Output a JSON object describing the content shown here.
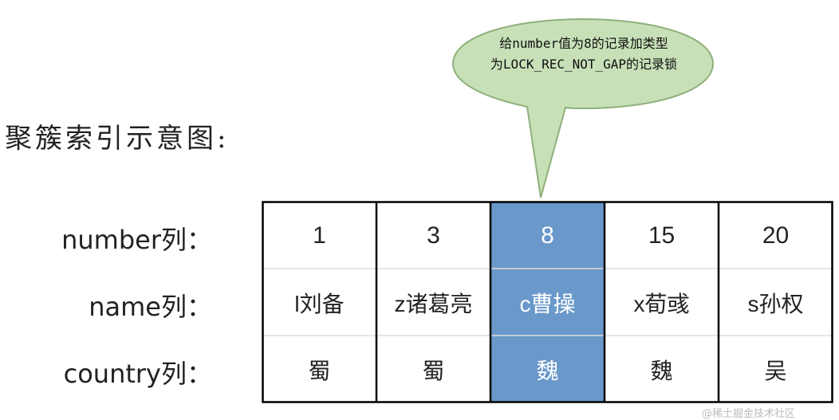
{
  "title": "聚簇索引示意图:",
  "callout": {
    "line1": "给number值为8的记录加类型",
    "line2": "为LOCK_REC_NOT_GAP的记录锁"
  },
  "row_labels": [
    "number列：",
    "name列：",
    "country列："
  ],
  "columns": [
    {
      "number": "1",
      "name": "l刘备",
      "country": "蜀"
    },
    {
      "number": "3",
      "name": "z诸葛亮",
      "country": "蜀"
    },
    {
      "number": "8",
      "name": "c曹操",
      "country": "魏"
    },
    {
      "number": "15",
      "name": "x荀彧",
      "country": "魏"
    },
    {
      "number": "20",
      "name": "s孙权",
      "country": "吴"
    }
  ],
  "highlight_column": 2,
  "colors": {
    "highlight": "#6a98ca",
    "callout_fill": "#c8e0b8",
    "callout_stroke": "#8fb07a"
  },
  "watermark": "@稀土掘金技术社区"
}
